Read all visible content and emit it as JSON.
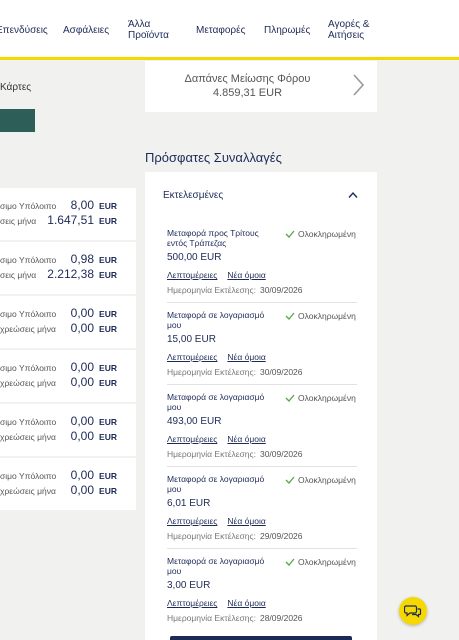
{
  "nav": {
    "items": [
      "Επενδύσεις",
      "Ασφάλειες",
      "Άλλα Προϊόντα",
      "Μεταφορές",
      "Πληρωμές",
      "Αγορές & Αιτήσεις"
    ]
  },
  "left": {
    "cards_label": "Κάρτες",
    "accounts": [
      {
        "label1": "σιμο Υπόλοιπο",
        "value1": "8,00",
        "label2": "σεις μήνα",
        "value2": "1.647,51",
        "currency": "EUR"
      },
      {
        "label1": "σιμο Υπόλοιπο",
        "value1": "0,98",
        "label2": "σεις μήνα",
        "value2": "2.212,38",
        "currency": "EUR"
      },
      {
        "label1": "σιμο Υπόλοιπο",
        "value1": "0,00",
        "label2": "χρεώσεις μήνα",
        "value2": "0,00",
        "currency": "EUR"
      },
      {
        "label1": "σιμο Υπόλοιπο",
        "value1": "0,00",
        "label2": "χρεώσεις μήνα",
        "value2": "0,00",
        "currency": "EUR"
      },
      {
        "label1": "σιμο Υπόλοιπο",
        "value1": "0,00",
        "label2": "χρεώσεις μήνα",
        "value2": "0,00",
        "currency": "EUR"
      },
      {
        "label1": "σιμο Υπόλοιπο",
        "value1": "0,00",
        "label2": "χρεώσεις μήνα",
        "value2": "0,00",
        "currency": "EUR"
      }
    ]
  },
  "tax": {
    "title": "Δαπάνες Μείωσης Φόρου",
    "amount": "4.859,31 EUR"
  },
  "recent": {
    "title": "Πρόσφατες Συναλλαγές",
    "section": "Εκτελεσμένες",
    "details_label": "Λεπτομέρειες",
    "similar_label": "Νέα όμοια",
    "date_label": "Ημερομηνία Εκτέλεσης:",
    "transactions": [
      {
        "title": "Μεταφορά προς Τρίτους εντός Τράπεζας",
        "status": "Ολοκληρωμένη",
        "amount": "500,00 EUR",
        "date": "30/09/2026"
      },
      {
        "title": "Μεταφορά σε λογαριασμό μου",
        "status": "Ολοκληρωμένη",
        "amount": "15,00 EUR",
        "date": "30/09/2026"
      },
      {
        "title": "Μεταφορά σε λογαριασμό μου",
        "status": "Ολοκληρωμένη",
        "amount": "493,00 EUR",
        "date": "30/09/2026"
      },
      {
        "title": "Μεταφορά σε λογαριασμό μου",
        "status": "Ολοκληρωμένη",
        "amount": "6,01 EUR",
        "date": "29/09/2026"
      },
      {
        "title": "Μεταφορά σε λογαριασμό μου",
        "status": "Ολοκληρωμένη",
        "amount": "3,00 EUR",
        "date": "28/09/2026"
      }
    ]
  },
  "colors": {
    "accent": "#f5d800",
    "navy": "#1d2a57",
    "teal": "#2e5e58",
    "success": "#5aa64b"
  },
  "icons": {
    "chat": "chat-icon",
    "check": "check-icon",
    "chevron_right": "chevron-right-icon",
    "chevron_up": "chevron-up-icon"
  }
}
